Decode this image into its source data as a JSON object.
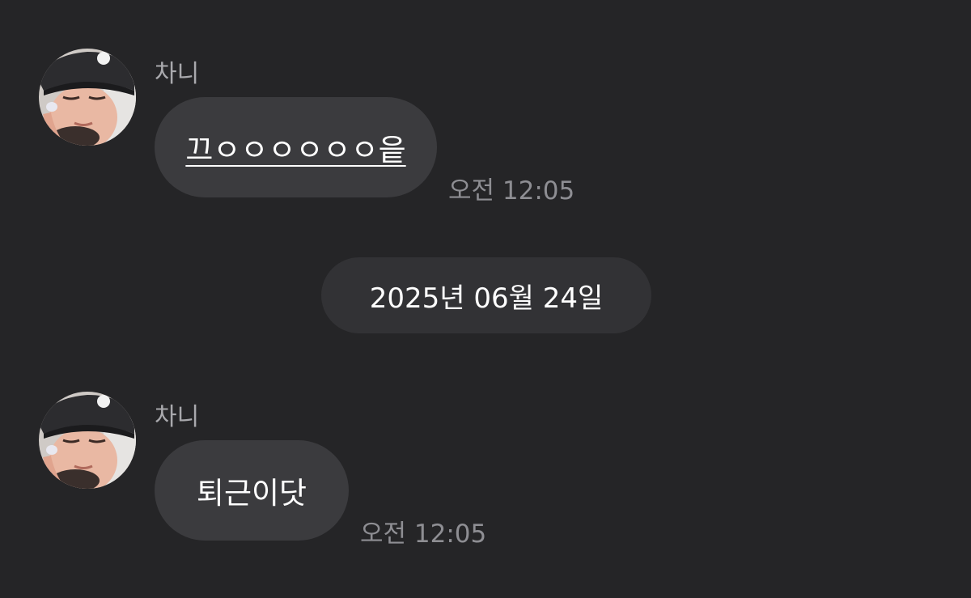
{
  "messages": [
    {
      "sender": "차니",
      "text": "끄ㅇㅇㅇㅇㅇㅇ읕",
      "time": "오전 12:05"
    },
    {
      "sender": "차니",
      "text": "퇴근이닷",
      "time": "오전 12:05"
    }
  ],
  "date_separator": "2025년 06월 24일",
  "colors": {
    "background": "#252527",
    "bubble": "#3b3b3e",
    "date_pill": "#323235",
    "sender_text": "#a9a9ad",
    "time_text": "#8e8e93",
    "message_text": "#ffffff"
  }
}
